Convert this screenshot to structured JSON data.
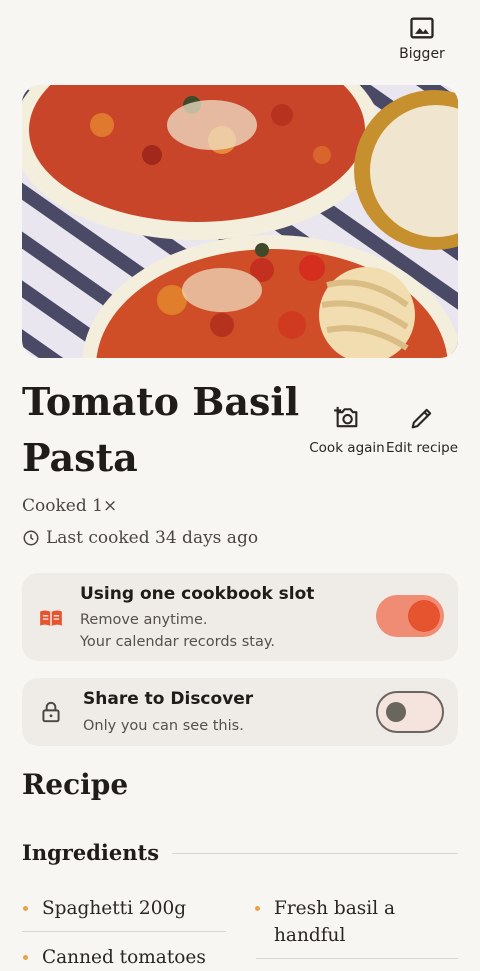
{
  "top_bar": {
    "bigger_label": "Bigger",
    "bigger_icon": "image-icon"
  },
  "hero": {
    "image_icon": "pasta-photo"
  },
  "recipe": {
    "title": "Tomato Basil Pasta",
    "cooked_count": "Cooked 1×",
    "last_cooked": "Last cooked 34 days ago"
  },
  "actions": {
    "cook_again": "Cook again",
    "edit_recipe": "Edit recipe"
  },
  "cookbook_slot": {
    "title": "Using one cookbook slot",
    "line1": "Remove anytime.",
    "line2": "Your calendar records stay.",
    "toggle_on": true
  },
  "share": {
    "title": "Share to Discover",
    "subtitle": "Only you can see this.",
    "toggle_on": false
  },
  "section": {
    "recipe_heading": "Recipe",
    "ingredients_heading": "Ingredients"
  },
  "ingredients": [
    "Spaghetti 200g",
    "Fresh basil a handful",
    "Canned tomatoes"
  ],
  "colors": {
    "accent": "#e5532f",
    "accent_light": "#f08c73",
    "bullet": "#e8a34a",
    "background": "#f8f6f3",
    "card": "#efebe6"
  }
}
